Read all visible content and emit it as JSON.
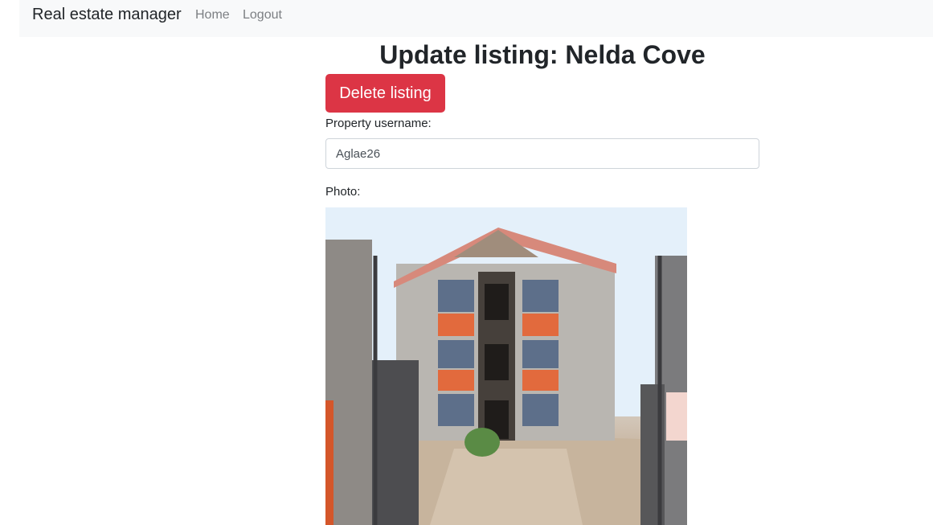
{
  "navbar": {
    "brand": "Real estate manager",
    "links": [
      {
        "label": "Home"
      },
      {
        "label": "Logout"
      }
    ]
  },
  "page": {
    "title": "Update listing: Nelda Cove",
    "delete_label": "Delete listing"
  },
  "form": {
    "username_label": "Property username:",
    "username_value": "Aglae26",
    "photo_label": "Photo:"
  },
  "colors": {
    "danger": "#dc3545",
    "navbar_bg": "#f8f9fa",
    "nav_link": "#7c7f83"
  }
}
